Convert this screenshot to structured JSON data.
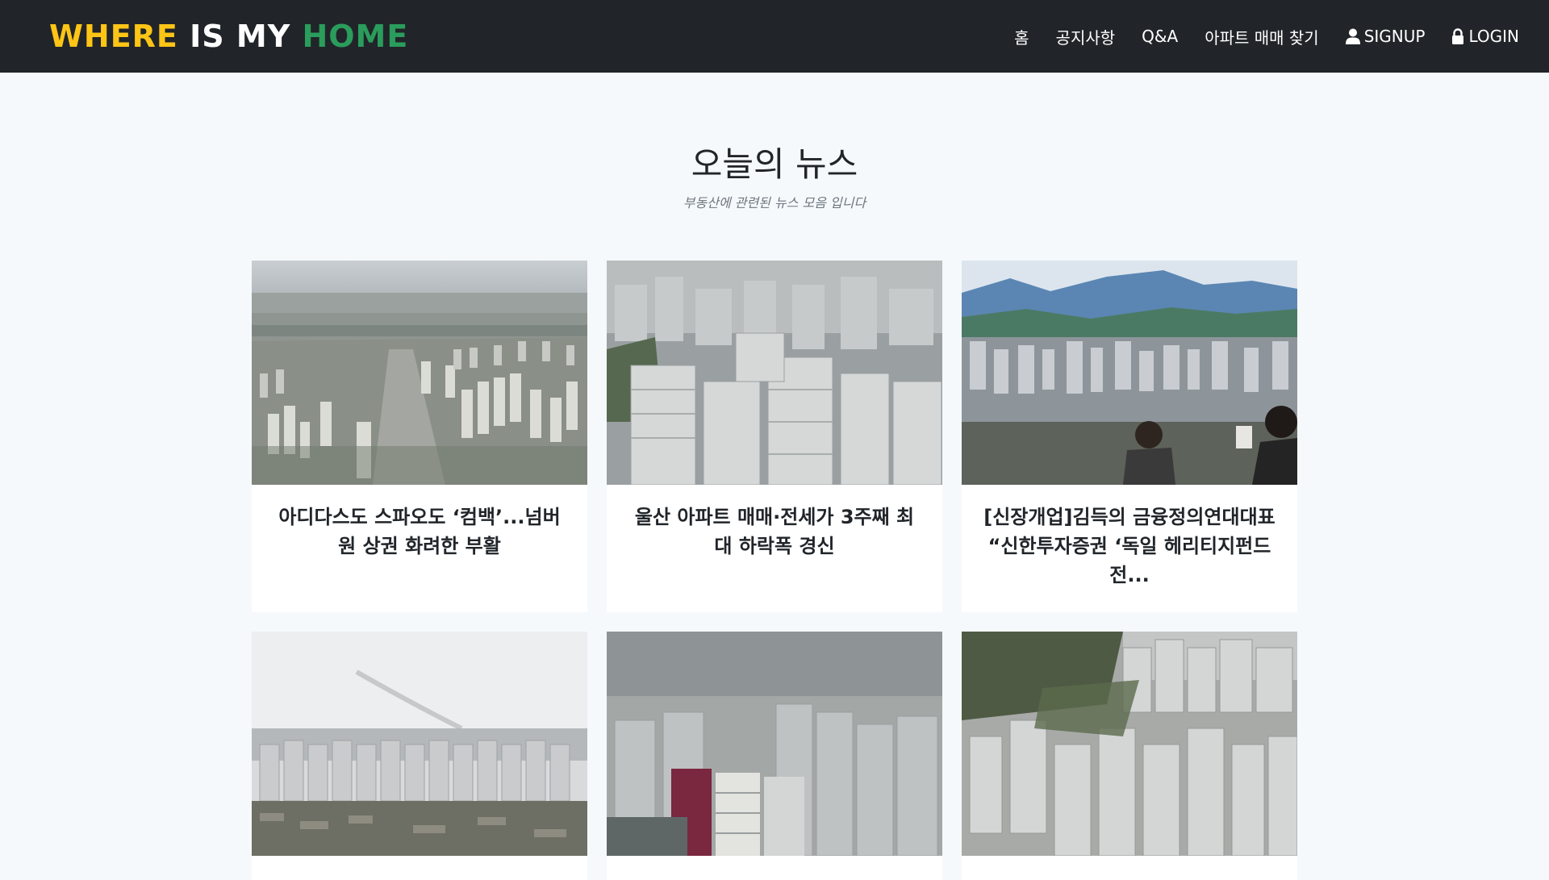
{
  "brand": {
    "part1": "WHERE",
    "part2": "IS MY",
    "part3": "HOME",
    "colors": {
      "yellow": "#ffc516",
      "white": "#ffffff",
      "green": "#2a9d5c"
    }
  },
  "nav": {
    "home": "홈",
    "notice": "공지사항",
    "qna": "Q&A",
    "apt_search": "아파트 매매 찾기",
    "signup": "SIGNUP",
    "login": "LOGIN"
  },
  "section": {
    "title": "오늘의 뉴스",
    "subtitle": "부동산에 관련된 뉴스 모음 입니다"
  },
  "news": [
    {
      "title": "아디다스도 스파오도 ‘컴백’...넘버원 상권 화려한 부활"
    },
    {
      "title": "울산 아파트 매매·전세가 3주째 최대 하락폭 경신"
    },
    {
      "title": "[신장개업]김득의 금융정의연대대표 “신한투자증권 ‘독일 헤리티지펀드 전..."
    },
    {
      "title": ""
    },
    {
      "title": ""
    },
    {
      "title": ""
    }
  ]
}
